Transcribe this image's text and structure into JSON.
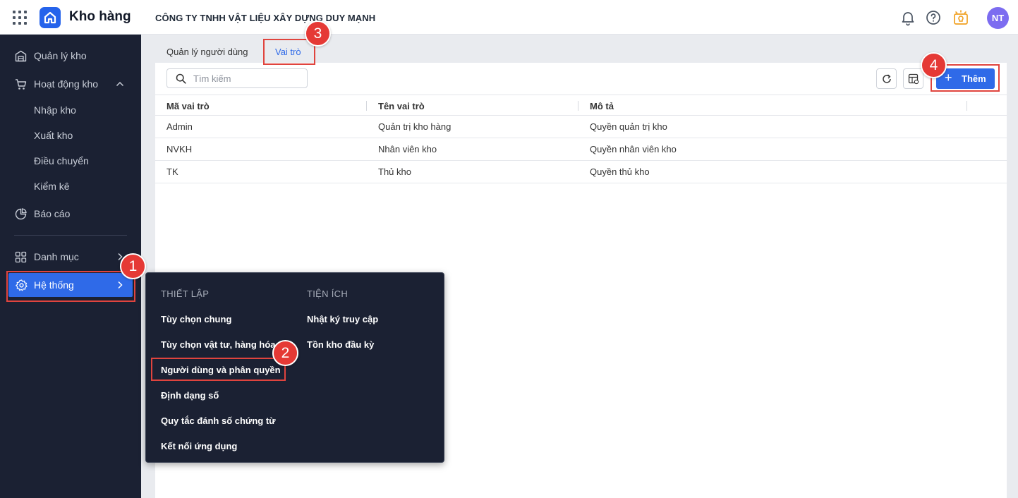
{
  "app": {
    "name": "Kho hàng",
    "company": "CÔNG TY TNHH VẬT LIỆU XÂY DỰNG DUY MẠNH"
  },
  "header": {
    "user_initials": "NT",
    "icons": [
      "apps-grid-icon",
      "bell-icon",
      "help-icon",
      "lightbulb-icon"
    ]
  },
  "sidebar": {
    "items": [
      {
        "label": "Quản lý kho",
        "icon": "warehouse-icon"
      },
      {
        "label": "Hoạt động kho",
        "icon": "cart-icon"
      },
      {
        "label": "Báo cáo",
        "icon": "pie-chart-icon"
      },
      {
        "label": "Danh mục",
        "icon": "grid-icon"
      },
      {
        "label": "Hệ thống",
        "icon": "gear-icon"
      }
    ],
    "subitems": [
      "Nhập kho",
      "Xuất kho",
      "Điều chuyển",
      "Kiểm kê"
    ]
  },
  "tabs": [
    "Quản lý người dùng",
    "Vai trò"
  ],
  "search": {
    "placeholder": "Tìm kiếm"
  },
  "toolbar": {
    "add_label": "Thêm"
  },
  "table": {
    "columns": [
      "Mã vai trò",
      "Tên vai trò",
      "Mô tả"
    ],
    "rows": [
      [
        "Admin",
        "Quản trị kho hàng",
        "Quyền quản trị kho"
      ],
      [
        "NVKH",
        "Nhân viên kho",
        "Quyền nhân viên kho"
      ],
      [
        "TK",
        "Thủ kho",
        "Quyền thủ kho"
      ]
    ]
  },
  "menu": {
    "setup_header": "THIẾT LẬP",
    "setup_items": [
      "Tùy chọn chung",
      "Tùy chọn vật tư, hàng hóa",
      "Người dùng và phân quyền",
      "Định dạng số",
      "Quy tắc đánh số chứng từ",
      "Kết nối ứng dụng"
    ],
    "utility_header": "TIỆN ÍCH",
    "utility_items": [
      "Nhật ký truy cập",
      "Tồn kho đầu kỳ"
    ]
  },
  "annotations": [
    "1",
    "2",
    "3",
    "4"
  ],
  "colors": {
    "accent": "#2f6ae8",
    "sidebar_bg": "#1b2133",
    "highlight": "#e0443e",
    "badge": "#e53935"
  }
}
